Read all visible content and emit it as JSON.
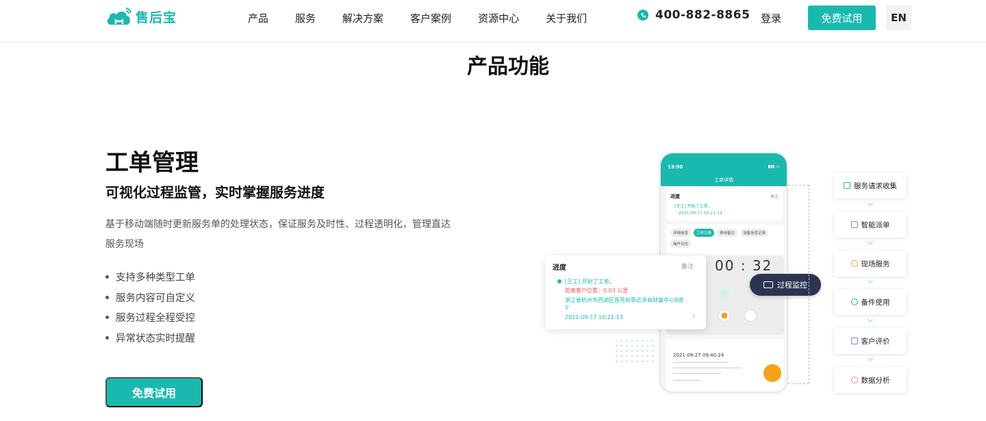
{
  "header": {
    "logo_text": "售后宝",
    "nav": [
      "产品",
      "服务",
      "解决方案",
      "客户案例",
      "资源中心",
      "关于我们"
    ],
    "phone": "400-882-8865",
    "login": "登录",
    "trial": "免费试用",
    "lang": "EN"
  },
  "section": {
    "title": "产品功能"
  },
  "feature": {
    "title": "工单管理",
    "subtitle": "可视化过程监管，实时掌握服务进度",
    "description": "基于移动端随时更新服务单的处理状态，保证服务及时性、过程透明化，管理直达服务现场",
    "bullets": [
      "支持多种类型工单",
      "服务内容可自定义",
      "服务过程全程受控",
      "异常状态实时提醒"
    ],
    "cta": "免费试用"
  },
  "illustration": {
    "phone_time": "13:50",
    "phone_title": "工单详情",
    "phone_progress": "进度",
    "phone_note": "备注",
    "phone_start": "[王工] 开始了工单。",
    "phone_start_time": "2021-09-17 10:21:13",
    "phone_tabs": [
      "详细信息",
      "工时记录",
      "费用备注",
      "设备信息记录",
      "操作日志"
    ],
    "phone_log_date": "2021-09-27 09:40:24",
    "popup": {
      "title": "进度",
      "note": "备注",
      "line1": "[王工] 开始了工单。",
      "line2": "距离客户位置：0.03 公里",
      "line3": "浙江省杭州市西湖区莲花街靠近浙商财富中心B座",
      "time": "2021-09-17 10:21:13"
    },
    "clock": "00 : 32",
    "monitor_label": "过程监控",
    "flow": [
      "服务请求收集",
      "智能派单",
      "现场服务",
      "备件使用",
      "客户评价",
      "数据分析"
    ]
  },
  "colors": {
    "accent": "#1ab9b0",
    "dark_pill": "#2b3550",
    "orange": "#f5a21b"
  }
}
